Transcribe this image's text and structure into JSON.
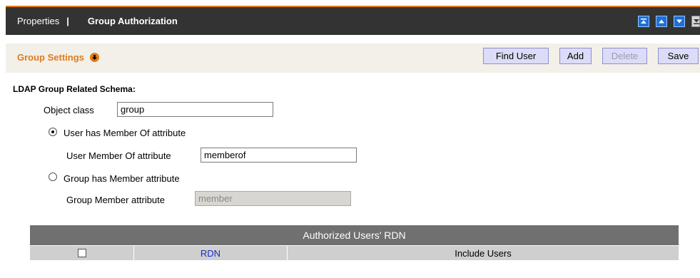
{
  "header": {
    "breadcrumb_root": "Properties",
    "separator": "|",
    "breadcrumb_current": "Group Authorization",
    "accent_color": "#e07b1a",
    "nav_icons": [
      "move-top-icon",
      "move-up-icon",
      "move-down-icon",
      "move-bottom-icon"
    ]
  },
  "toolbar": {
    "title": "Group Settings",
    "find_user_label": "Find User",
    "add_label": "Add",
    "delete_label": "Delete",
    "save_label": "Save"
  },
  "schema": {
    "section_title": "LDAP Group Related Schema:",
    "object_class_label": "Object class",
    "object_class_value": "group",
    "option_user_member_of": "User has Member Of attribute",
    "user_member_of_label": "User Member Of attribute",
    "user_member_of_value": "memberof",
    "option_group_member": "Group has Member attribute",
    "group_member_label": "Group Member attribute",
    "group_member_value": "member",
    "selected_option": "User has Member Of attribute"
  },
  "grid": {
    "title": "Authorized Users' RDN",
    "columns": [
      "RDN",
      "Include Users"
    ]
  }
}
